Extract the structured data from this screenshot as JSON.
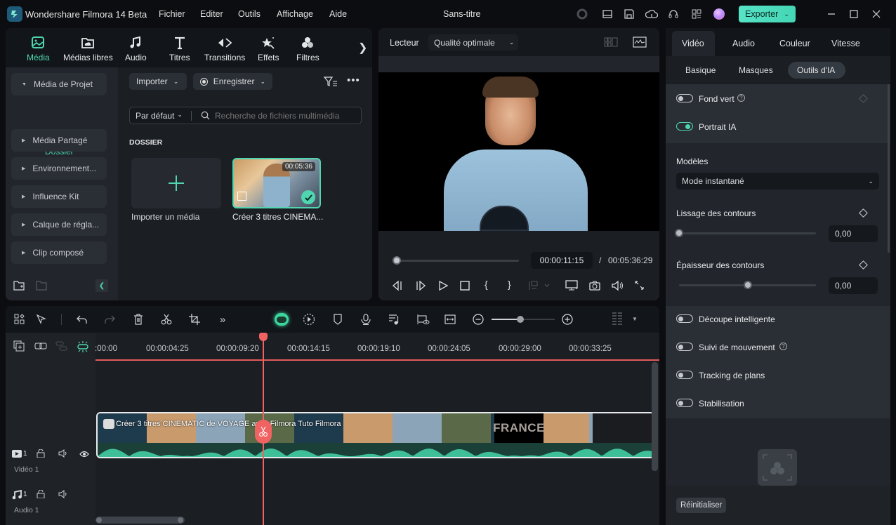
{
  "app": {
    "title": "Wondershare Filmora 14 Beta",
    "document_title": "Sans-titre",
    "menu": [
      "Fichier",
      "Editer",
      "Outils",
      "Affichage",
      "Aide"
    ],
    "toolbar_icons": [
      "record-indicator-icon",
      "layout-icon",
      "save-icon",
      "cloud-upload-icon",
      "headset-icon",
      "apps-grid-icon",
      "account-avatar"
    ],
    "export_label": "Exporter",
    "accent_color": "#4fd6b1",
    "playhead_color": "#f16262"
  },
  "media_panel": {
    "tabs": [
      {
        "label": "Média",
        "icon": "media-icon",
        "active": true
      },
      {
        "label": "Médias libres",
        "icon": "stock-media-icon",
        "active": false
      },
      {
        "label": "Audio",
        "icon": "music-note-icon",
        "active": false
      },
      {
        "label": "Titres",
        "icon": "titles-icon",
        "active": false
      },
      {
        "label": "Transitions",
        "icon": "transitions-icon",
        "active": false
      },
      {
        "label": "Effets",
        "icon": "effects-icon",
        "active": false
      },
      {
        "label": "Filtres",
        "icon": "filters-icon",
        "active": false
      }
    ],
    "sidebar": {
      "project_media": "Média de Projet",
      "folder": "Dossier",
      "items": [
        "Média Partagé",
        "Environnement...",
        "Influence Kit",
        "Calque de régla...",
        "Clip composé"
      ]
    },
    "import_label": "Importer",
    "record_label": "Enregistrer",
    "sort_label": "Par défaut",
    "search_placeholder": "Recherche de fichiers multimédia",
    "section_heading": "DOSSIER",
    "import_card_label": "Importer un média",
    "clip": {
      "name": "Créer 3 titres CINEMA...",
      "duration": "00:05:36"
    }
  },
  "player": {
    "label": "Lecteur",
    "quality": "Qualité optimale",
    "current_time": "00:00:11:15",
    "separator": "/",
    "total_time": "00:05:36:29",
    "progress_fraction": 0.034
  },
  "properties": {
    "tabs": [
      {
        "label": "Vidéo",
        "active": true
      },
      {
        "label": "Audio",
        "active": false
      },
      {
        "label": "Couleur",
        "active": false
      },
      {
        "label": "Vitesse",
        "active": false
      }
    ],
    "subtabs": [
      {
        "label": "Basique",
        "active": false
      },
      {
        "label": "Masques",
        "active": false
      },
      {
        "label": "Outils d'IA",
        "active": true
      }
    ],
    "fond_vert": {
      "label": "Fond vert",
      "enabled": false
    },
    "portrait_ia": {
      "label": "Portrait IA",
      "enabled": true
    },
    "models_label": "Modèles",
    "models_value": "Mode instantané",
    "edge_smoothing": {
      "label": "Lissage des contours",
      "value": "0,00",
      "slider_fraction": 0.0
    },
    "edge_thickness": {
      "label": "Épaisseur des contours",
      "value": "0,00",
      "slider_fraction": 0.5
    },
    "smart_cutout": {
      "label": "Découpe intelligente",
      "enabled": false
    },
    "motion_tracking": {
      "label": "Suivi de mouvement",
      "enabled": false
    },
    "plane_tracking": {
      "label": "Tracking de plans",
      "enabled": false
    },
    "stabilization": {
      "label": "Stabilisation",
      "enabled": false
    },
    "reset_label": "Réinitialiser"
  },
  "timeline": {
    "ruler": [
      ":00:00",
      "00:00:04:25",
      "00:00:09:20",
      "00:00:14:15",
      "00:00:19:10",
      "00:00:24:05",
      "00:00:29:00",
      "00:00:33:25"
    ],
    "zoom_fraction": 0.45,
    "video_track": {
      "number": "1",
      "label": "Vidéo 1"
    },
    "audio_track": {
      "number": "1",
      "label": "Audio 1"
    },
    "clip_title": "Créer 3 titres CINEMATIC de VOYAGE avec Filmora  Tuto Filmora",
    "clip_overlay_text": "FRANCE"
  }
}
